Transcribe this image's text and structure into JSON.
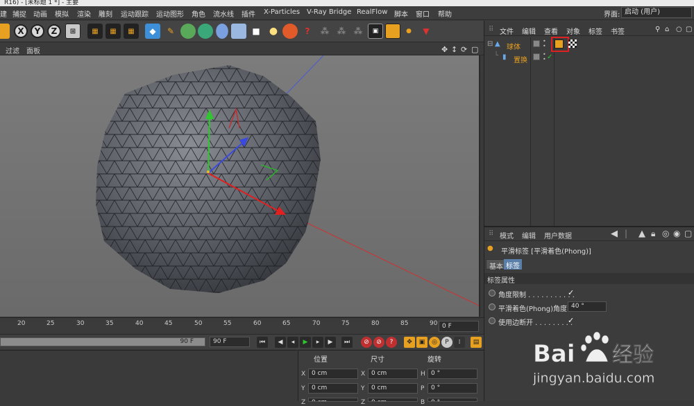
{
  "window": {
    "title": "R16) - [未标题 1 *] - 主要"
  },
  "menubar": {
    "items": [
      "建",
      "捕捉",
      "动画",
      "模拟",
      "渲染",
      "雕刻",
      "运动跟踪",
      "运动图形",
      "角色",
      "流水线",
      "插件",
      "X-Particles",
      "V-Ray Bridge",
      "RealFlow",
      "脚本",
      "窗口",
      "帮助"
    ],
    "layout_label": "界面:",
    "layout_value": "启动 (用户)"
  },
  "toolbar": {
    "axis_x": "X",
    "axis_y": "Y",
    "axis_z": "Z"
  },
  "viewport": {
    "tabs": [
      "过滤",
      "面板"
    ]
  },
  "timeline": {
    "ticks": [
      "20",
      "25",
      "30",
      "35",
      "40",
      "45",
      "50",
      "55",
      "60",
      "65",
      "70",
      "75",
      "80",
      "85",
      "90"
    ],
    "current_frame": "0 F"
  },
  "transport": {
    "range_end": "90 F",
    "end_field": "90 F"
  },
  "coordinates": {
    "headers": {
      "position": "位置",
      "size": "尺寸",
      "rotation": "旋转"
    },
    "rows": [
      {
        "axis": "X",
        "pos": "0 cm",
        "size_axis": "X",
        "size": "0 cm",
        "rot_axis": "H",
        "rot": "0 °"
      },
      {
        "axis": "Y",
        "pos": "0 cm",
        "size_axis": "Y",
        "size": "0 cm",
        "rot_axis": "P",
        "rot": "0 °"
      },
      {
        "axis": "Z",
        "pos": "0 cm",
        "size_axis": "Z",
        "size": "0 cm",
        "rot_axis": "B",
        "rot": "0 °"
      }
    ]
  },
  "object_manager": {
    "menu": [
      "文件",
      "编辑",
      "查看",
      "对象",
      "标签",
      "书签"
    ],
    "objects": [
      {
        "name": "球体",
        "color": "#e8a020"
      },
      {
        "name": "置换",
        "color": "#e8a020"
      }
    ]
  },
  "attribute_manager": {
    "menu": [
      "模式",
      "编辑",
      "用户数据"
    ],
    "title": "平滑标签 [平滑着色(Phong)]",
    "tabs": [
      "基本",
      "标签"
    ],
    "section": "标签属性",
    "props": [
      {
        "label": "角度限制 . . . . . . . . . . .",
        "checked": true
      },
      {
        "label": "平滑着色(Phong)角度",
        "value": "40 °"
      },
      {
        "label": "使用边断开 . . . . . . . . .",
        "checked": true
      }
    ]
  },
  "watermark": {
    "brand": "Bai",
    "brand_cn": "经验",
    "url": "jingyan.baidu.com"
  },
  "colors": {
    "accent": "#e8a020",
    "selection": "#5a7fa8",
    "tag_highlight": "#e02020"
  }
}
